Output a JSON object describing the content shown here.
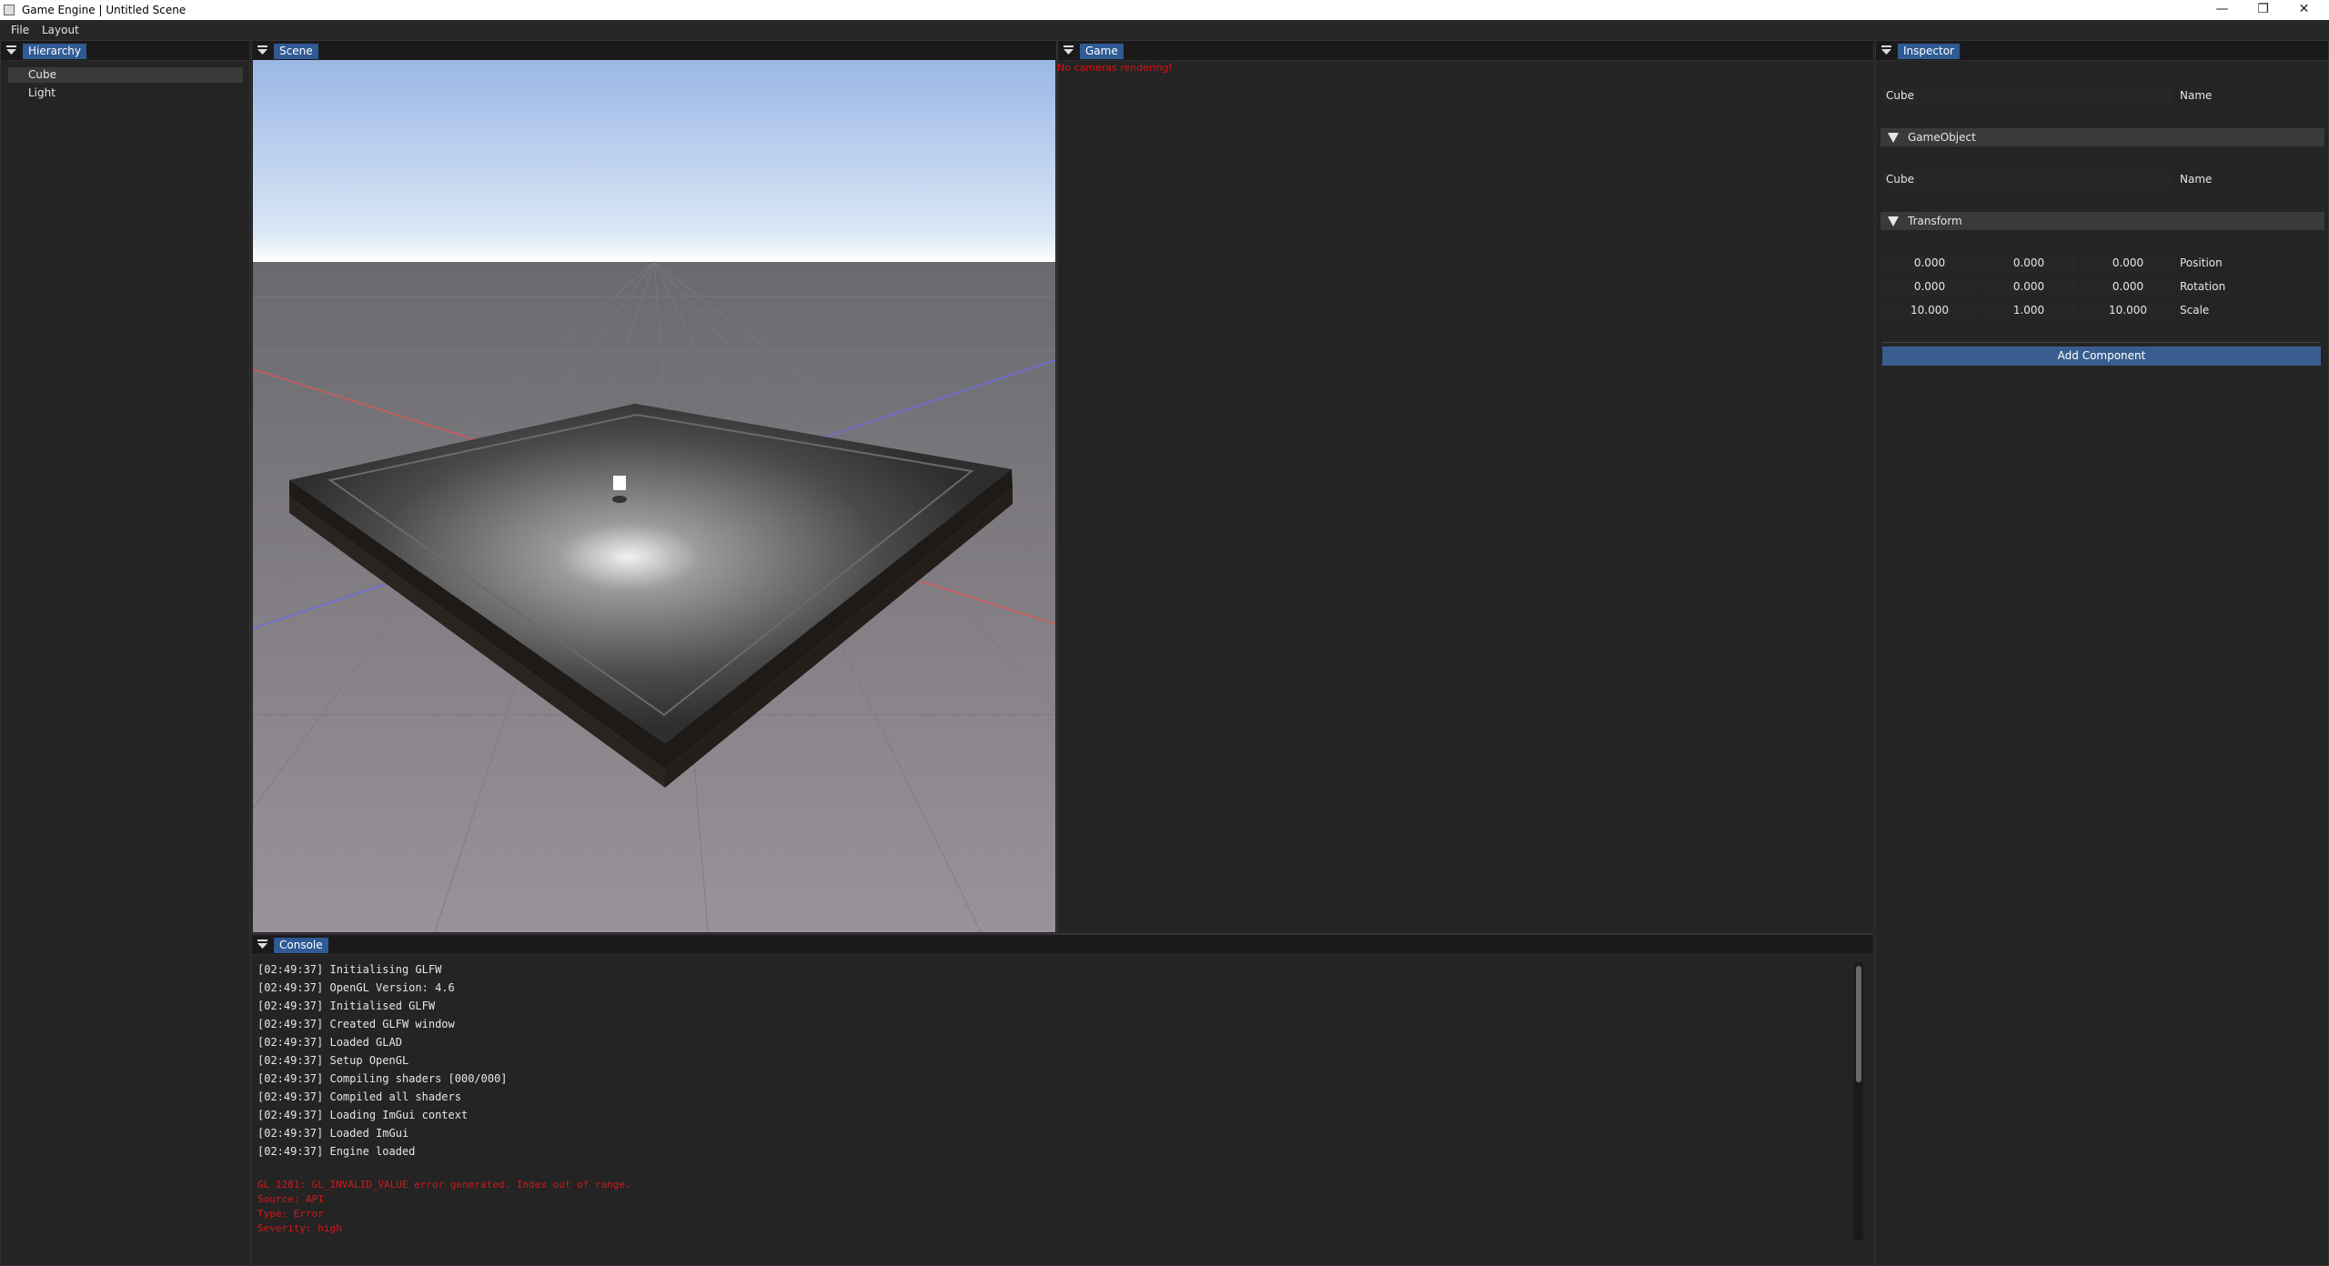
{
  "window": {
    "title": "Game Engine | Untitled Scene",
    "minimize_glyph": "—",
    "restore_glyph": "❐",
    "close_glyph": "✕"
  },
  "menubar": {
    "items": [
      "File",
      "Layout"
    ]
  },
  "hierarchy": {
    "tab": "Hierarchy",
    "items": [
      {
        "label": "Cube",
        "selected": true
      },
      {
        "label": "Light",
        "selected": false
      }
    ]
  },
  "scene": {
    "tab": "Scene"
  },
  "game": {
    "tab": "Game",
    "message": "No cameras rendering!"
  },
  "inspector": {
    "tab": "Inspector",
    "object_name": "Cube",
    "name_label": "Name",
    "sections": {
      "gameobject": {
        "title": "GameObject",
        "name_value": "Cube",
        "name_label": "Name"
      },
      "transform": {
        "title": "Transform",
        "rows": [
          {
            "label": "Position",
            "values": [
              "0.000",
              "0.000",
              "0.000"
            ]
          },
          {
            "label": "Rotation",
            "values": [
              "0.000",
              "0.000",
              "0.000"
            ]
          },
          {
            "label": "Scale",
            "values": [
              "10.000",
              "1.000",
              "10.000"
            ]
          }
        ]
      }
    },
    "add_component_label": "Add Component"
  },
  "console": {
    "tab": "Console",
    "lines": [
      "[02:49:37] Initialising GLFW",
      "[02:49:37] OpenGL Version: 4.6",
      "[02:49:37] Initialised GLFW",
      "[02:49:37] Created GLFW window",
      "[02:49:37] Loaded GLAD",
      "[02:49:37] Setup OpenGL",
      "[02:49:37] Compiling shaders [000/000]",
      "[02:49:37] Compiled all shaders",
      "[02:49:37] Loading ImGui context",
      "[02:49:37] Loaded ImGui",
      "[02:49:37] Engine loaded"
    ],
    "error_lines": [
      "GL 1281: GL_INVALID_VALUE error generated. Index out of range.",
      "Source: API",
      "Type: Error",
      "Severity: high"
    ]
  },
  "colors": {
    "accent_tab": "#2f5a94",
    "error_text": "#d01818",
    "button": "#3a5d8f"
  }
}
